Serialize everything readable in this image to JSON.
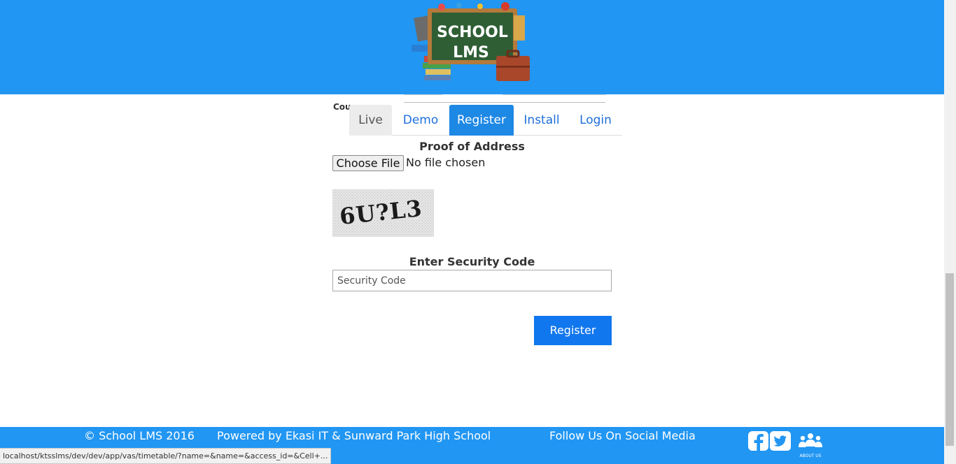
{
  "header": {
    "logo_line1": "SCHOOL",
    "logo_line2": "LMS"
  },
  "behind_header": {
    "country_label": "Cou"
  },
  "tabs": [
    {
      "label": "Live"
    },
    {
      "label": "Demo"
    },
    {
      "label": "Register",
      "active": true
    },
    {
      "label": "Install"
    },
    {
      "label": "Login"
    }
  ],
  "form": {
    "proof_title": "Proof of Address",
    "file_button": "Choose File",
    "file_status": "No file chosen",
    "captcha_text": "6U?L3",
    "security_title": "Enter Security Code",
    "security_placeholder": "Security Code",
    "security_value": "",
    "register_button": "Register"
  },
  "footer": {
    "copyright": "© School LMS 2016",
    "powered_by": "Powered by Ekasi IT & Sunward Park High School",
    "follow": "Follow Us On Social Media",
    "about_label": "ABOUT US",
    "icons": [
      "facebook-icon",
      "twitter-icon",
      "about-us-icon"
    ]
  },
  "status_bar": {
    "url": "localhost/ktsslms/dev/dev/app/vas/timetable/?name=&name=&access_id=&Cell+..."
  },
  "colors": {
    "header_bg": "#2196f3",
    "active_tab": "#1e88e5",
    "button": "#1177ee",
    "link": "#1e6fd9"
  }
}
